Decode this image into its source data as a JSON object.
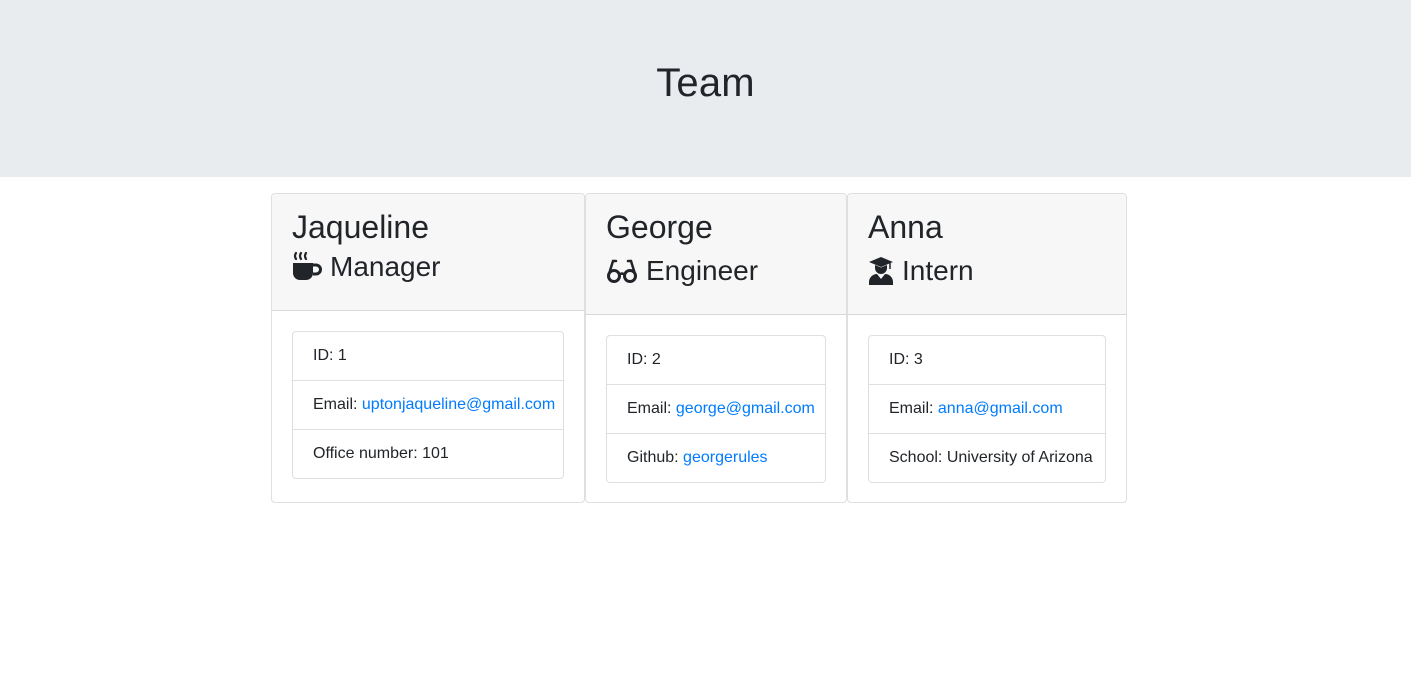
{
  "header": {
    "title": "Team"
  },
  "members": [
    {
      "name": "Jaqueline",
      "role": "Manager",
      "role_icon": "coffee-icon",
      "id_label": "ID: ",
      "id": "1",
      "email_label": "Email: ",
      "email": "uptonjaqueline@gmail.com",
      "extra_label": "Office number: ",
      "extra_value": "101"
    },
    {
      "name": "George",
      "role": "Engineer",
      "role_icon": "glasses-icon",
      "id_label": "ID: ",
      "id": "2",
      "email_label": "Email: ",
      "email": "george@gmail.com",
      "extra_label": "Github: ",
      "extra_value": "georgerules"
    },
    {
      "name": "Anna",
      "role": "Intern",
      "role_icon": "user-graduate-icon",
      "id_label": "ID: ",
      "id": "3",
      "email_label": "Email: ",
      "email": "anna@gmail.com",
      "extra_label": "School: ",
      "extra_value": "University of Arizona"
    }
  ],
  "colors": {
    "jumbotron_bg": "#e9ecef",
    "card_header_bg": "#f7f7f7",
    "link": "#007bff",
    "text": "#212529"
  }
}
